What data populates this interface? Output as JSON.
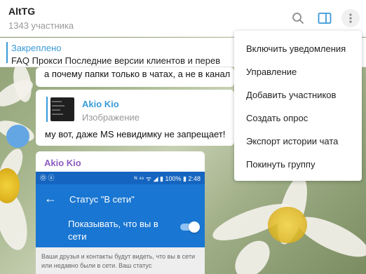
{
  "header": {
    "title": "AltTG",
    "subtitle": "1343 участника"
  },
  "pinned": {
    "label": "Закреплено",
    "text": "FAQ  Прокси   Последние версии клиентов и перев"
  },
  "messages": {
    "partial_text": "а почему папки только в чатах, а не в канал",
    "reply_name": "Akio Kio",
    "reply_type": "Изображение",
    "text": "му вот, даже MS невидимку не запрещает!",
    "sender": "Akio Kio"
  },
  "screenshot": {
    "status_icons": "Ⓞ ⓧ",
    "status_right": "ᴺ ⁴⁶ ᯤ ◢ ▮ 100% ▮ 2:48",
    "back_icon": "←",
    "app_title": "Статус \"В сети\"",
    "setting_label": "Показывать, что вы в сети",
    "description": "Ваши друзья и контакты будут видеть, что вы в сети или недавно были в сети. Ваш статус"
  },
  "menu": {
    "items": [
      "Включить уведомления",
      "Управление",
      "Добавить участников",
      "Создать опрос",
      "Экспорт истории чата",
      "Покинуть группу"
    ]
  },
  "colors": {
    "accent": "#3a9ad9",
    "sender": "#8e5dbf",
    "android_blue": "#1976d2"
  },
  "icons": [
    "search-icon",
    "sidebar-toggle-icon",
    "more-vertical-icon"
  ]
}
